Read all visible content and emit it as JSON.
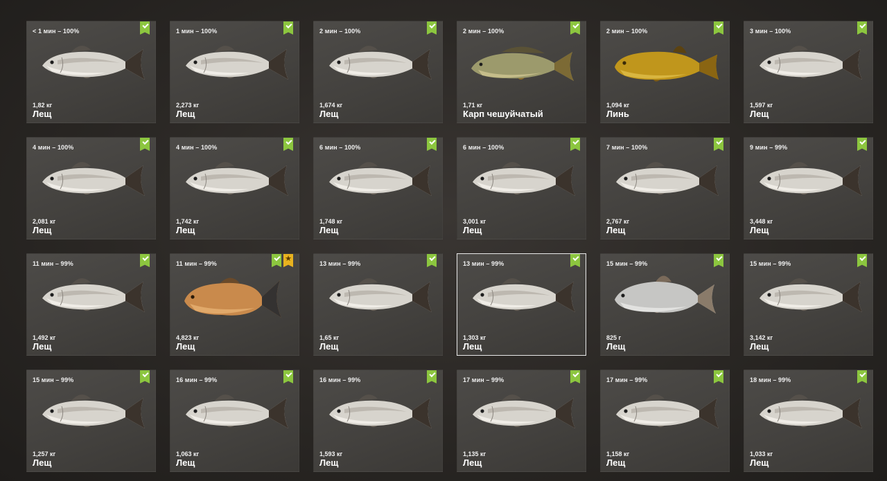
{
  "catches": [
    {
      "time": "< 1 мин – 100%",
      "weight": "1,82 кг",
      "species": "Лещ",
      "fish": "bream",
      "badges": [
        "check"
      ]
    },
    {
      "time": "1 мин – 100%",
      "weight": "2,273 кг",
      "species": "Лещ",
      "fish": "bream",
      "badges": [
        "check"
      ]
    },
    {
      "time": "2 мин – 100%",
      "weight": "1,674 кг",
      "species": "Лещ",
      "fish": "bream",
      "badges": [
        "check"
      ]
    },
    {
      "time": "2 мин – 100%",
      "weight": "1,71 кг",
      "species": "Карп чешуйчатый",
      "fish": "carp",
      "badges": [
        "check"
      ]
    },
    {
      "time": "2 мин – 100%",
      "weight": "1,094 кг",
      "species": "Линь",
      "fish": "tench",
      "badges": [
        "check"
      ]
    },
    {
      "time": "3 мин – 100%",
      "weight": "1,597 кг",
      "species": "Лещ",
      "fish": "bream",
      "badges": [
        "check"
      ]
    },
    {
      "time": "4 мин – 100%",
      "weight": "2,081 кг",
      "species": "Лещ",
      "fish": "bream",
      "badges": [
        "check"
      ]
    },
    {
      "time": "4 мин – 100%",
      "weight": "1,742 кг",
      "species": "Лещ",
      "fish": "bream",
      "badges": [
        "check"
      ]
    },
    {
      "time": "6 мин – 100%",
      "weight": "1,748 кг",
      "species": "Лещ",
      "fish": "bream",
      "badges": [
        "check"
      ]
    },
    {
      "time": "6 мин – 100%",
      "weight": "3,001 кг",
      "species": "Лещ",
      "fish": "bream",
      "badges": [
        "check"
      ]
    },
    {
      "time": "7 мин – 100%",
      "weight": "2,767 кг",
      "species": "Лещ",
      "fish": "bream",
      "badges": [
        "check"
      ]
    },
    {
      "time": "9 мин – 99%",
      "weight": "3,448 кг",
      "species": "Лещ",
      "fish": "bream",
      "badges": [
        "check"
      ]
    },
    {
      "time": "11 мин – 99%",
      "weight": "1,492 кг",
      "species": "Лещ",
      "fish": "bream",
      "badges": [
        "check"
      ]
    },
    {
      "time": "11 мин – 99%",
      "weight": "4,823 кг",
      "species": "Лещ",
      "fish": "golden-bream",
      "badges": [
        "check",
        "star"
      ]
    },
    {
      "time": "13 мин – 99%",
      "weight": "1,65 кг",
      "species": "Лещ",
      "fish": "bream",
      "badges": [
        "check"
      ]
    },
    {
      "time": "13 мин – 99%",
      "weight": "1,303 кг",
      "species": "Лещ",
      "fish": "bream",
      "badges": [
        "check"
      ],
      "selected": true
    },
    {
      "time": "15 мин – 99%",
      "weight": "825 г",
      "species": "Лещ",
      "fish": "silver-bream",
      "badges": [
        "check"
      ]
    },
    {
      "time": "15 мин – 99%",
      "weight": "3,142 кг",
      "species": "Лещ",
      "fish": "bream",
      "badges": [
        "check"
      ]
    },
    {
      "time": "15 мин – 99%",
      "weight": "1,257 кг",
      "species": "Лещ",
      "fish": "bream",
      "badges": [
        "check"
      ]
    },
    {
      "time": "16 мин – 99%",
      "weight": "1,063 кг",
      "species": "Лещ",
      "fish": "bream",
      "badges": [
        "check"
      ]
    },
    {
      "time": "16 мин – 99%",
      "weight": "1,593 кг",
      "species": "Лещ",
      "fish": "bream",
      "badges": [
        "check"
      ]
    },
    {
      "time": "17 мин – 99%",
      "weight": "1,135 кг",
      "species": "Лещ",
      "fish": "bream",
      "badges": [
        "check"
      ]
    },
    {
      "time": "17 мин – 99%",
      "weight": "1,158 кг",
      "species": "Лещ",
      "fish": "bream",
      "badges": [
        "check"
      ]
    },
    {
      "time": "18 мин – 99%",
      "weight": "1,033 кг",
      "species": "Лещ",
      "fish": "bream",
      "badges": [
        "check"
      ]
    }
  ],
  "colors": {
    "badge_check": "#8cc63f",
    "badge_star": "#e8b21f",
    "card_bg": "#474542",
    "selected_border": "#e9e9e9"
  }
}
